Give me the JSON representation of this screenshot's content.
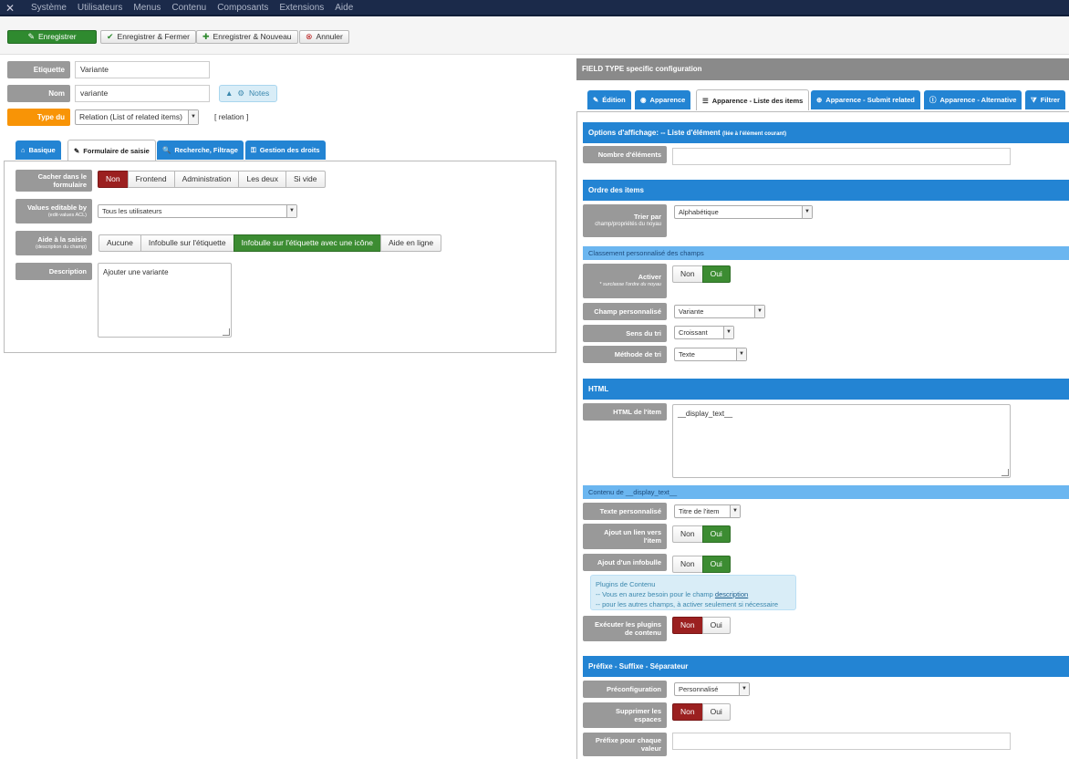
{
  "menubar": {
    "items": [
      "Système",
      "Utilisateurs",
      "Menus",
      "Contenu",
      "Composants",
      "Extensions",
      "Aide"
    ]
  },
  "toolbar": {
    "save": "Enregistrer",
    "save_close": "Enregistrer & Fermer",
    "save_new": "Enregistrer & Nouveau",
    "cancel": "Annuler"
  },
  "form": {
    "label_label": "Etiquette",
    "label_value": "Variante",
    "name_label": "Nom",
    "name_value": "variante",
    "notes_button": "Notes",
    "type_label": "Type du champ",
    "type_value": "Relation (List of related items)",
    "type_code": "[ relation ]"
  },
  "left_tabs": [
    "Basique",
    "Formulaire de saisie",
    "Recherche, Filtrage",
    "Gestion des droits"
  ],
  "left_panel": {
    "hide_label": "Cacher dans le formulaire",
    "hide_options": [
      "Non",
      "Frontend",
      "Administration",
      "Les deux",
      "Si vide"
    ],
    "editable_label": "Values editable by",
    "editable_sub": "(edit-values ACL)",
    "editable_value": "Tous les utilisateurs",
    "help_label": "Aide à la saisie",
    "help_sub": "(description du champ)",
    "help_options": [
      "Aucune",
      "Infobulle sur l'étiquette",
      "Infobulle sur l'étiquette avec une icône",
      "Aide en ligne"
    ],
    "desc_label": "Description",
    "desc_value": "Ajouter une variante"
  },
  "right": {
    "header": "FIELD TYPE specific configuration",
    "tabs": [
      "Édition",
      "Apparence",
      "Apparence - Liste des items",
      "Apparence - Submit related",
      "Apparence - Alternative",
      "Filtrer"
    ],
    "display_bar": "Options d'affichage: -- Liste d'élément",
    "display_bar_sub": "(liée à l'élément courant)",
    "count_label": "Nombre d'éléments",
    "order_bar": "Ordre des items",
    "sort_label": "Trier par",
    "sort_sub": "champ/propriétés du noyau",
    "sort_value": "Alphabétique",
    "custom_order_bar": "Classement personnalisé des champs",
    "activate_label": "Activer",
    "activate_sub": "* surclasse l'ordre du noyau",
    "custom_field_label": "Champ personnalisé",
    "custom_field_value": "Variante",
    "sort_dir_label": "Sens du tri",
    "sort_dir_value": "Croissant",
    "sort_method_label": "Méthode de tri",
    "sort_method_value": "Texte",
    "html_bar": "HTML",
    "html_item_label": "HTML de l'item",
    "html_item_value": "__display_text__",
    "display_text_bar": "Contenu de __display_text__",
    "custom_text_label": "Texte personnalisé",
    "custom_text_value": "Titre de l'item",
    "link_label": "Ajout un lien vers l'item",
    "tooltip_label": "Ajout d'un infobulle",
    "info_title": "Plugins de Contenu",
    "info_line1": "-- Vous en aurez besoin pour le champ",
    "info_link": "description",
    "info_line2": "-- pour les autres champs, à activer seulement si nécessaire",
    "plugins_label": "Exécuter les plugins de contenu",
    "prefix_bar": "Préfixe - Suffixe - Séparateur",
    "preconf_label": "Préconfiguration",
    "preconf_value": "Personnalisé",
    "strip_label": "Supprimer les espaces",
    "prefix_label": "Préfixe pour chaque valeur",
    "yes": "Oui",
    "no": "Non"
  },
  "colors": {
    "accent": "#2384d3",
    "success": "#3c8c32",
    "danger": "#9b2020",
    "warning": "#f89406"
  }
}
